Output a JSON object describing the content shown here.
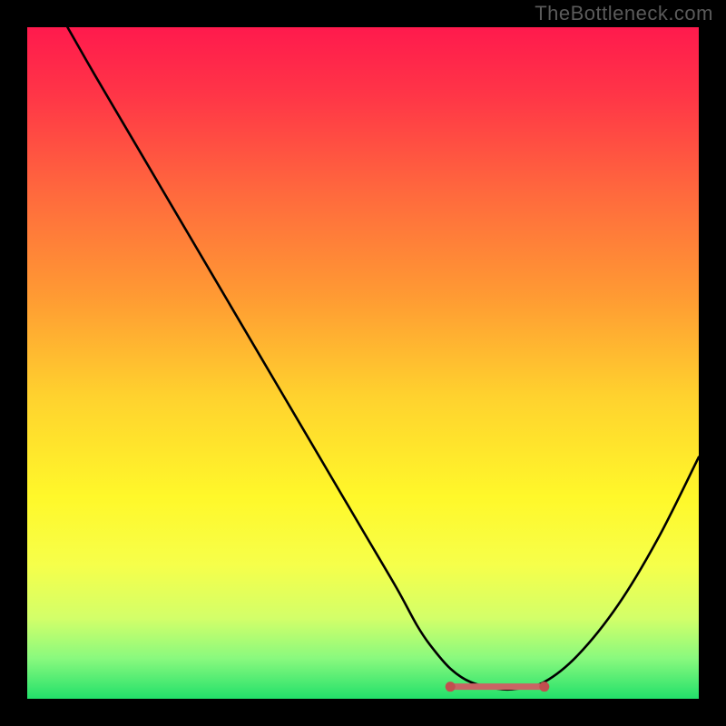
{
  "watermark": "TheBottleneck.com",
  "colors": {
    "frame": "#000000",
    "watermark": "#5a5a5a",
    "curve": "#000000",
    "flat": "#c96464",
    "flat_dot": "#c24f4f",
    "gradient_stops": [
      {
        "offset": "0%",
        "color": "#ff1a4d"
      },
      {
        "offset": "10%",
        "color": "#ff3547"
      },
      {
        "offset": "25%",
        "color": "#ff6a3d"
      },
      {
        "offset": "40%",
        "color": "#ff9a33"
      },
      {
        "offset": "55%",
        "color": "#ffd22e"
      },
      {
        "offset": "70%",
        "color": "#fff82a"
      },
      {
        "offset": "80%",
        "color": "#f6ff4a"
      },
      {
        "offset": "88%",
        "color": "#d3ff69"
      },
      {
        "offset": "94%",
        "color": "#89f97e"
      },
      {
        "offset": "100%",
        "color": "#22e06a"
      }
    ]
  },
  "chart_data": {
    "type": "line",
    "title": "",
    "xlabel": "",
    "ylabel": "",
    "xlim": [
      0,
      100
    ],
    "ylim": [
      0,
      100
    ],
    "series": [
      {
        "name": "bottleneck_curve",
        "x": [
          6,
          10,
          15,
          20,
          25,
          30,
          35,
          40,
          45,
          50,
          55,
          58,
          60,
          63,
          66,
          70,
          73,
          77,
          82,
          88,
          94,
          100
        ],
        "values": [
          100,
          93,
          84.5,
          76,
          67.5,
          59,
          50.5,
          42,
          33.5,
          25,
          16.5,
          11,
          8,
          4.5,
          2.5,
          1.5,
          1.5,
          2.5,
          6.5,
          14,
          24,
          36
        ]
      }
    ],
    "flat_region": {
      "x_start": 63,
      "x_end": 77,
      "y": 1.8
    },
    "gradient_axis": "vertical",
    "gradient_meaning": "red=high bottleneck, green=low bottleneck"
  }
}
